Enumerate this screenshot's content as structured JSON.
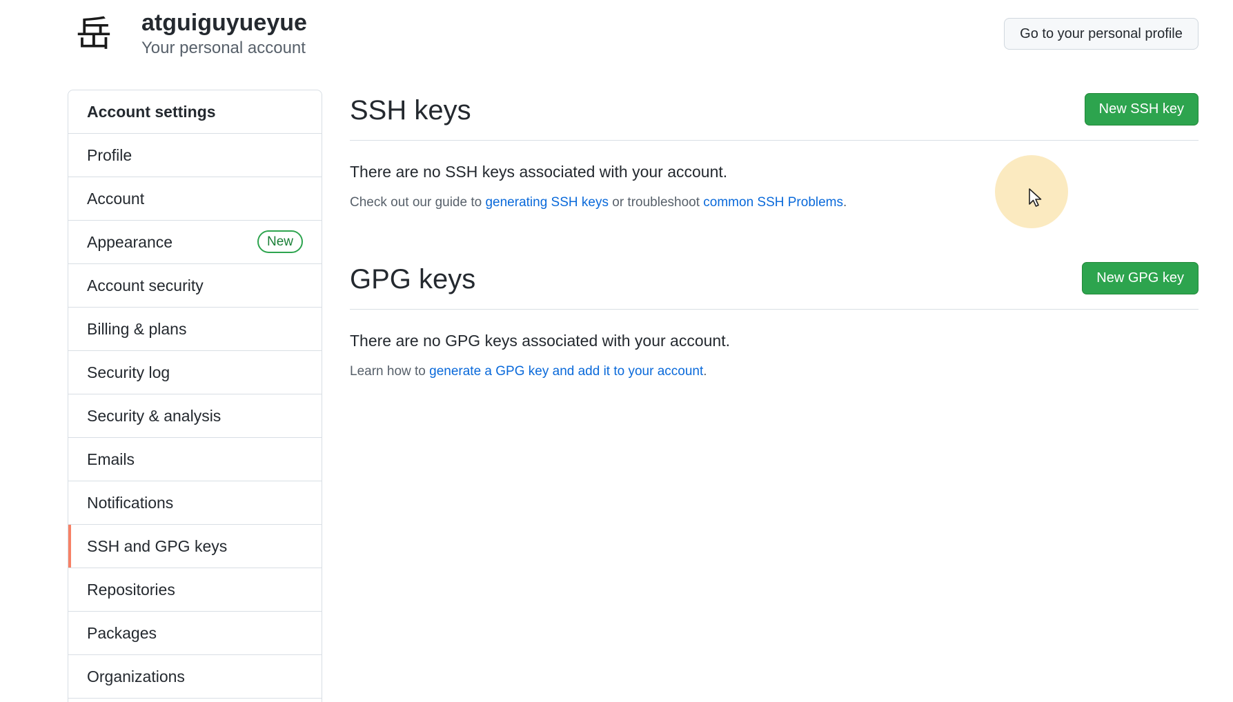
{
  "header": {
    "avatar_glyph": "岳",
    "username": "atguiguyueyue",
    "subtitle": "Your personal account",
    "profile_button": "Go to your personal profile"
  },
  "sidebar": {
    "heading": "Account settings",
    "items": [
      {
        "label": "Profile"
      },
      {
        "label": "Account"
      },
      {
        "label": "Appearance",
        "badge": "New"
      },
      {
        "label": "Account security"
      },
      {
        "label": "Billing & plans"
      },
      {
        "label": "Security log"
      },
      {
        "label": "Security & analysis"
      },
      {
        "label": "Emails"
      },
      {
        "label": "Notifications"
      },
      {
        "label": "SSH and GPG keys",
        "active": true
      },
      {
        "label": "Repositories"
      },
      {
        "label": "Packages"
      },
      {
        "label": "Organizations"
      }
    ]
  },
  "ssh": {
    "title": "SSH keys",
    "new_button": "New SSH key",
    "empty_message": "There are no SSH keys associated with your account.",
    "help_prefix": "Check out our guide to ",
    "help_link1": "generating SSH keys",
    "help_middle": " or troubleshoot ",
    "help_link2": "common SSH Problems",
    "help_suffix": "."
  },
  "gpg": {
    "title": "GPG keys",
    "new_button": "New GPG key",
    "empty_message": "There are no GPG keys associated with your account.",
    "help_prefix": "Learn how to ",
    "help_link": "generate a GPG key and add it to your account",
    "help_suffix": "."
  },
  "colors": {
    "primary_button": "#2da44e",
    "link": "#0969da",
    "active_indicator": "#f78166",
    "cursor_highlight": "#f8d88c"
  }
}
